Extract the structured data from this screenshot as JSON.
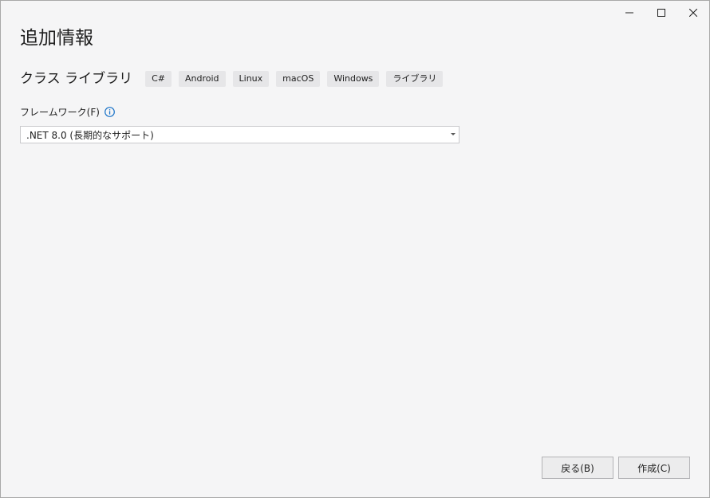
{
  "window": {
    "title": "追加情報",
    "controls": {
      "minimize": "minimize-icon",
      "maximize": "maximize-icon",
      "close": "close-icon"
    }
  },
  "template": {
    "name": "クラス ライブラリ",
    "tags": [
      "C#",
      "Android",
      "Linux",
      "macOS",
      "Windows",
      "ライブラリ"
    ]
  },
  "framework": {
    "label": "フレームワーク(F)",
    "info_icon": "info-icon",
    "selected": ".NET 8.0 (長期的なサポート)"
  },
  "buttons": {
    "back": "戻る(B)",
    "create": "作成(C)"
  },
  "colors": {
    "background": "#f5f5f6",
    "tag_background": "#e6e6e8",
    "info_accent": "#1a73c8",
    "button_background": "#ececed"
  }
}
